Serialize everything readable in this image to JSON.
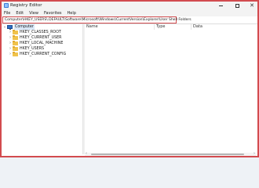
{
  "window": {
    "title": "Registry Editor",
    "controls": {
      "minimize": "",
      "maximize": "",
      "close": "✕"
    }
  },
  "menu": [
    "File",
    "Edit",
    "View",
    "Favorites",
    "Help"
  ],
  "address": {
    "path": "Computer\\HKEY_USERS\\.DEFAULT\\Software\\Microsoft\\Windows\\CurrentVersion\\Explorer\\User Shell Folders"
  },
  "tree": {
    "root": {
      "label": "Computer",
      "icon": "computer-icon",
      "expanded": true,
      "selected": true
    },
    "items": [
      {
        "label": "HKEY_CLASSES_ROOT",
        "icon": "folder-icon"
      },
      {
        "label": "HKEY_CURRENT_USER",
        "icon": "folder-icon"
      },
      {
        "label": "HKEY_LOCAL_MACHINE",
        "icon": "folder-icon"
      },
      {
        "label": "HKEY_USERS",
        "icon": "folder-icon"
      },
      {
        "label": "HKEY_CURRENT_CONFIG",
        "icon": "folder-icon"
      }
    ],
    "chevron_collapsed": "›",
    "chevron_expanded": "⌄"
  },
  "list": {
    "columns": [
      "Name",
      "Type",
      "Data"
    ]
  },
  "scrollbar": {
    "left": "‹",
    "right": "›"
  },
  "colors": {
    "highlight_border": "#d24b4f",
    "selection": "#d9e7f7",
    "folder": "#f0c24b"
  }
}
